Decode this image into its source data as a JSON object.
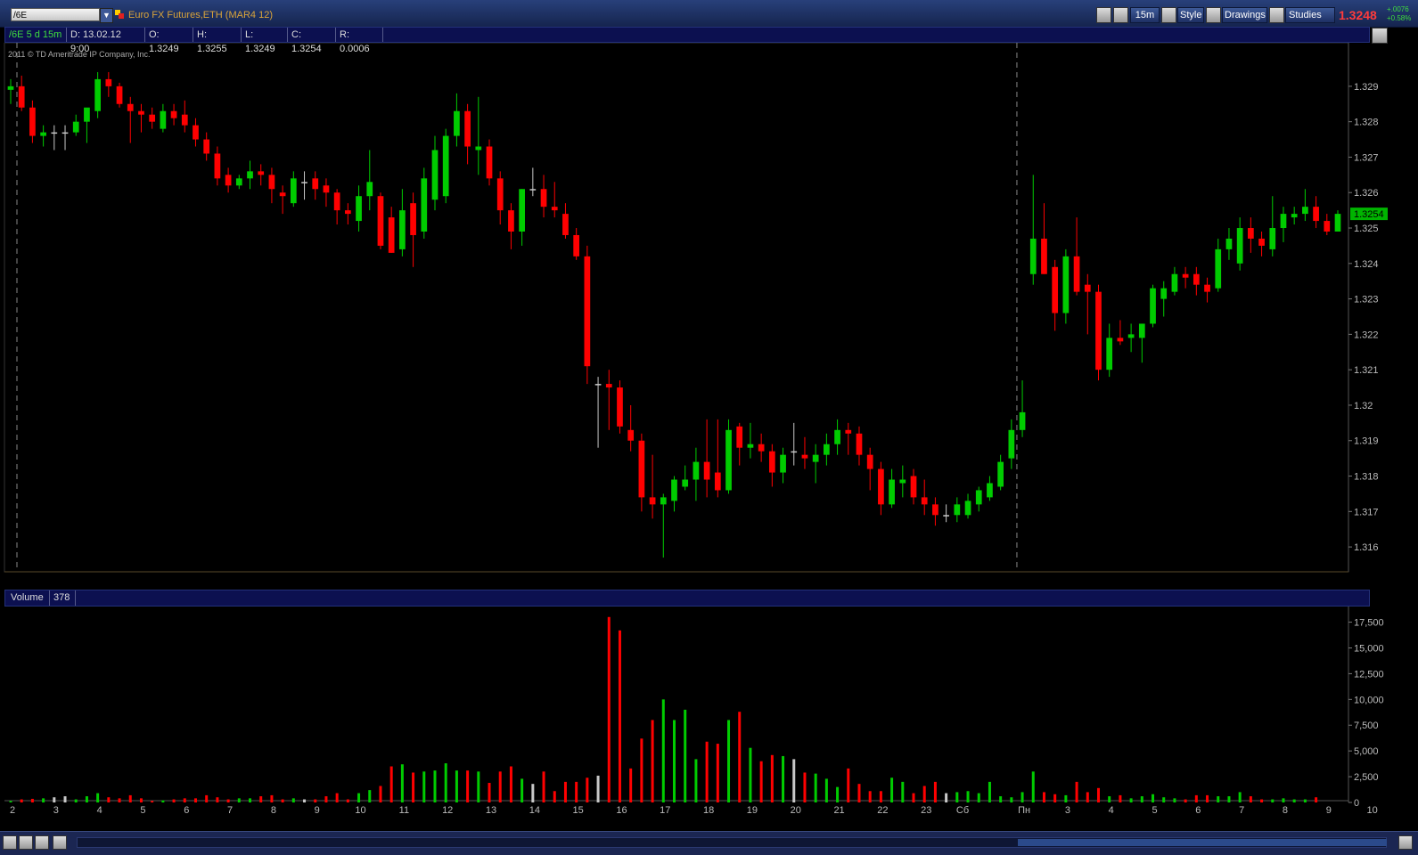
{
  "toolbar": {
    "symbol": "/6E",
    "instrument": "Euro FX Futures,ETH (MAR4 12)",
    "timeframe": "15m",
    "style_label": "Style",
    "drawings_label": "Drawings",
    "studies_label": "Studies",
    "last_price": "1.3248",
    "change_abs": "+.0076",
    "change_pct": "+0.58%",
    "colors": {
      "up": "#00cc00",
      "down": "#ff0000",
      "neutral": "#c8c8c8",
      "price_label_bg": "#00b400"
    }
  },
  "infobar": {
    "period": "/6E 5 d 15m",
    "date": "D: 13.02.12 9:00",
    "open": "O: 1.3249",
    "high": "H: 1.3255",
    "low": "L: 1.3249",
    "close": "C: 1.3254",
    "range": "R: 0.0006"
  },
  "copyright": "2011 © TD Ameritrade IP Company, Inc.",
  "volume_panel": {
    "label": "Volume",
    "value": "378"
  },
  "chart_data": [
    {
      "type": "candlestick",
      "title": "",
      "ylim": [
        1.3155,
        1.3296
      ],
      "y_ticks": [
        "1.329",
        "1.328",
        "1.327",
        "1.326",
        "1.325",
        "1.324",
        "1.323",
        "1.322",
        "1.321",
        "1.32",
        "1.319",
        "1.318",
        "1.317",
        "1.316"
      ],
      "current_price_label": "1.3254",
      "grid": false,
      "session_breaks": [
        0,
        93
      ],
      "x_tick_labels": [
        {
          "label": "2",
          "i": 0
        },
        {
          "label": "3",
          "i": 4
        },
        {
          "label": "4",
          "i": 8
        },
        {
          "label": "5",
          "i": 12
        },
        {
          "label": "6",
          "i": 16
        },
        {
          "label": "7",
          "i": 20
        },
        {
          "label": "8",
          "i": 24
        },
        {
          "label": "9",
          "i": 28
        },
        {
          "label": "10",
          "i": 32
        },
        {
          "label": "11",
          "i": 36
        },
        {
          "label": "12",
          "i": 40
        },
        {
          "label": "13",
          "i": 44
        },
        {
          "label": "14",
          "i": 48
        },
        {
          "label": "15",
          "i": 52
        },
        {
          "label": "16",
          "i": 56
        },
        {
          "label": "17",
          "i": 60
        },
        {
          "label": "18",
          "i": 64
        },
        {
          "label": "19",
          "i": 68
        },
        {
          "label": "20",
          "i": 72
        },
        {
          "label": "21",
          "i": 76
        },
        {
          "label": "22",
          "i": 80
        },
        {
          "label": "23",
          "i": 84
        },
        {
          "label": "Сб",
          "i": 88
        },
        {
          "label": "Пн",
          "i": 93
        },
        {
          "label": "3",
          "i": 97
        },
        {
          "label": "4",
          "i": 101
        },
        {
          "label": "5",
          "i": 105
        },
        {
          "label": "6",
          "i": 109
        },
        {
          "label": "7",
          "i": 113
        },
        {
          "label": "8",
          "i": 117
        },
        {
          "label": "9",
          "i": 121
        },
        {
          "label": "10",
          "i": 125
        }
      ],
      "candles": [
        [
          1.3289,
          1.3292,
          1.3285,
          1.329
        ],
        [
          1.329,
          1.3293,
          1.3283,
          1.3284
        ],
        [
          1.3284,
          1.3286,
          1.3274,
          1.3276
        ],
        [
          1.3276,
          1.3279,
          1.3273,
          1.3277
        ],
        [
          1.3277,
          1.3279,
          1.3272,
          1.3277
        ],
        [
          1.3277,
          1.3279,
          1.3272,
          1.3277
        ],
        [
          1.3277,
          1.3282,
          1.3276,
          1.328
        ],
        [
          1.328,
          1.3283,
          1.3274,
          1.3284
        ],
        [
          1.3283,
          1.3294,
          1.3281,
          1.3292
        ],
        [
          1.3292,
          1.3294,
          1.3287,
          1.329
        ],
        [
          1.329,
          1.3291,
          1.3284,
          1.3285
        ],
        [
          1.3285,
          1.3287,
          1.3274,
          1.3283
        ],
        [
          1.3283,
          1.3285,
          1.3277,
          1.3282
        ],
        [
          1.3282,
          1.3284,
          1.3278,
          1.328
        ],
        [
          1.3278,
          1.3285,
          1.3277,
          1.3283
        ],
        [
          1.3283,
          1.3285,
          1.3279,
          1.3281
        ],
        [
          1.3282,
          1.3286,
          1.3277,
          1.3279
        ],
        [
          1.3279,
          1.3281,
          1.3273,
          1.3275
        ],
        [
          1.3275,
          1.3277,
          1.3269,
          1.3271
        ],
        [
          1.3271,
          1.3273,
          1.3262,
          1.3264
        ],
        [
          1.3265,
          1.3267,
          1.326,
          1.3262
        ],
        [
          1.3262,
          1.3265,
          1.3261,
          1.3264
        ],
        [
          1.3264,
          1.3269,
          1.3261,
          1.3266
        ],
        [
          1.3266,
          1.3268,
          1.3262,
          1.3265
        ],
        [
          1.3265,
          1.3267,
          1.3257,
          1.3261
        ],
        [
          1.326,
          1.3262,
          1.3254,
          1.3259
        ],
        [
          1.3257,
          1.3266,
          1.3256,
          1.3264
        ],
        [
          1.3263,
          1.3266,
          1.3258,
          1.3263
        ],
        [
          1.3264,
          1.3266,
          1.3258,
          1.3261
        ],
        [
          1.3262,
          1.3264,
          1.3256,
          1.326
        ],
        [
          1.326,
          1.3261,
          1.3251,
          1.3255
        ],
        [
          1.3255,
          1.3257,
          1.3251,
          1.3254
        ],
        [
          1.3252,
          1.3262,
          1.3249,
          1.3259
        ],
        [
          1.3259,
          1.3272,
          1.3255,
          1.3263
        ],
        [
          1.3259,
          1.326,
          1.3244,
          1.3245
        ],
        [
          1.3253,
          1.3256,
          1.3243,
          1.3243
        ],
        [
          1.3244,
          1.3261,
          1.3242,
          1.3255
        ],
        [
          1.3257,
          1.326,
          1.3239,
          1.3248
        ],
        [
          1.3249,
          1.3267,
          1.3247,
          1.3264
        ],
        [
          1.3258,
          1.3276,
          1.3255,
          1.3272
        ],
        [
          1.3259,
          1.3278,
          1.3257,
          1.3276
        ],
        [
          1.3276,
          1.3288,
          1.3273,
          1.3283
        ],
        [
          1.3283,
          1.3285,
          1.3268,
          1.3273
        ],
        [
          1.3272,
          1.3287,
          1.3265,
          1.3273
        ],
        [
          1.3273,
          1.3275,
          1.3262,
          1.3264
        ],
        [
          1.3264,
          1.3266,
          1.3251,
          1.3255
        ],
        [
          1.3255,
          1.3257,
          1.3244,
          1.3249
        ],
        [
          1.3249,
          1.3261,
          1.3245,
          1.3261
        ],
        [
          1.3261,
          1.3267,
          1.3259,
          1.3261
        ],
        [
          1.3261,
          1.3265,
          1.3253,
          1.3256
        ],
        [
          1.3256,
          1.3263,
          1.3253,
          1.3255
        ],
        [
          1.3254,
          1.3257,
          1.3247,
          1.3248
        ],
        [
          1.3248,
          1.325,
          1.3241,
          1.3242
        ],
        [
          1.3242,
          1.3245,
          1.3206,
          1.3211
        ],
        [
          1.3206,
          1.3208,
          1.3188,
          1.3206
        ],
        [
          1.3206,
          1.321,
          1.3193,
          1.3205
        ],
        [
          1.3205,
          1.3207,
          1.3192,
          1.3194
        ],
        [
          1.3193,
          1.32,
          1.3187,
          1.319
        ],
        [
          1.319,
          1.3192,
          1.317,
          1.3174
        ],
        [
          1.3174,
          1.3186,
          1.3168,
          1.3172
        ],
        [
          1.3172,
          1.3175,
          1.3157,
          1.3174
        ],
        [
          1.3173,
          1.318,
          1.317,
          1.3179
        ],
        [
          1.3177,
          1.3183,
          1.3176,
          1.3179
        ],
        [
          1.3179,
          1.3188,
          1.3173,
          1.3184
        ],
        [
          1.3184,
          1.3196,
          1.3174,
          1.3179
        ],
        [
          1.3181,
          1.3196,
          1.3174,
          1.3176
        ],
        [
          1.3176,
          1.3196,
          1.3175,
          1.3193
        ],
        [
          1.3194,
          1.3195,
          1.3183,
          1.3188
        ],
        [
          1.3188,
          1.3195,
          1.3185,
          1.3189
        ],
        [
          1.3189,
          1.3192,
          1.3184,
          1.3187
        ],
        [
          1.3187,
          1.3189,
          1.3177,
          1.3181
        ],
        [
          1.3181,
          1.3188,
          1.3178,
          1.3186
        ],
        [
          1.3187,
          1.3195,
          1.3183,
          1.3187
        ],
        [
          1.3186,
          1.3191,
          1.3182,
          1.3185
        ],
        [
          1.3184,
          1.3189,
          1.3178,
          1.3186
        ],
        [
          1.3186,
          1.3192,
          1.3183,
          1.3189
        ],
        [
          1.3189,
          1.3196,
          1.3186,
          1.3193
        ],
        [
          1.3193,
          1.3195,
          1.3186,
          1.3192
        ],
        [
          1.3192,
          1.3194,
          1.3183,
          1.3186
        ],
        [
          1.3186,
          1.3188,
          1.3176,
          1.3182
        ],
        [
          1.3182,
          1.3184,
          1.3169,
          1.3172
        ],
        [
          1.3172,
          1.3182,
          1.3171,
          1.3179
        ],
        [
          1.3178,
          1.3183,
          1.3174,
          1.3179
        ],
        [
          1.318,
          1.3182,
          1.3172,
          1.3174
        ],
        [
          1.3174,
          1.3179,
          1.3169,
          1.3172
        ],
        [
          1.3172,
          1.3174,
          1.3166,
          1.3169
        ],
        [
          1.3169,
          1.3172,
          1.3167,
          1.3169
        ],
        [
          1.3169,
          1.3174,
          1.3167,
          1.3172
        ],
        [
          1.3169,
          1.3175,
          1.3168,
          1.3173
        ],
        [
          1.3172,
          1.3177,
          1.317,
          1.3176
        ],
        [
          1.3174,
          1.318,
          1.3173,
          1.3178
        ],
        [
          1.3177,
          1.3186,
          1.3176,
          1.3184
        ],
        [
          1.3185,
          1.3196,
          1.3182,
          1.3193
        ],
        [
          1.3193,
          1.3207,
          1.3191,
          1.3198
        ],
        [
          1.3237,
          1.3265,
          1.3234,
          1.3247
        ],
        [
          1.3247,
          1.3257,
          1.3237,
          1.3237
        ],
        [
          1.3239,
          1.3241,
          1.3221,
          1.3226
        ],
        [
          1.3226,
          1.3244,
          1.3223,
          1.3242
        ],
        [
          1.3242,
          1.3253,
          1.3231,
          1.3232
        ],
        [
          1.3234,
          1.3237,
          1.322,
          1.3232
        ],
        [
          1.3232,
          1.3234,
          1.3207,
          1.321
        ],
        [
          1.321,
          1.3223,
          1.3208,
          1.3219
        ],
        [
          1.3219,
          1.3224,
          1.3217,
          1.3218
        ],
        [
          1.3219,
          1.3223,
          1.3215,
          1.322
        ],
        [
          1.3219,
          1.3223,
          1.3212,
          1.3223
        ],
        [
          1.3223,
          1.3234,
          1.3222,
          1.3233
        ],
        [
          1.323,
          1.3235,
          1.3225,
          1.3233
        ],
        [
          1.3232,
          1.3239,
          1.3231,
          1.3237
        ],
        [
          1.3237,
          1.3239,
          1.3233,
          1.3236
        ],
        [
          1.3237,
          1.3239,
          1.3231,
          1.3234
        ],
        [
          1.3234,
          1.3236,
          1.3229,
          1.3232
        ],
        [
          1.3233,
          1.3247,
          1.3232,
          1.3244
        ],
        [
          1.3244,
          1.325,
          1.3241,
          1.3247
        ],
        [
          1.324,
          1.3253,
          1.3238,
          1.325
        ],
        [
          1.325,
          1.3253,
          1.3243,
          1.3247
        ],
        [
          1.3247,
          1.3249,
          1.3242,
          1.3245
        ],
        [
          1.3244,
          1.3259,
          1.3242,
          1.325
        ],
        [
          1.325,
          1.3256,
          1.3246,
          1.3254
        ],
        [
          1.3253,
          1.3256,
          1.3251,
          1.3254
        ],
        [
          1.3254,
          1.3261,
          1.3252,
          1.3256
        ],
        [
          1.3256,
          1.3259,
          1.325,
          1.3252
        ],
        [
          1.3252,
          1.3254,
          1.3248,
          1.3249
        ],
        [
          1.3249,
          1.3255,
          1.3249,
          1.3254
        ]
      ]
    },
    {
      "type": "bar",
      "title": "Volume",
      "ylim": [
        0,
        18500
      ],
      "y_ticks": [
        "17,500",
        "15,000",
        "12,500",
        "10,000",
        "7,500",
        "5,000",
        "2,500",
        "0"
      ],
      "values": [
        150,
        300,
        350,
        400,
        500,
        600,
        300,
        600,
        900,
        500,
        400,
        700,
        400,
        150,
        200,
        300,
        400,
        400,
        700,
        500,
        300,
        400,
        400,
        600,
        700,
        300,
        400,
        300,
        300,
        600,
        900,
        300,
        900,
        1200,
        1600,
        3500,
        3700,
        2900,
        3000,
        3100,
        3800,
        3100,
        3100,
        3000,
        1900,
        3000,
        3500,
        2300,
        1800,
        3000,
        1100,
        2000,
        2000,
        2400,
        2600,
        18000,
        16700,
        3300,
        6200,
        8000,
        10000,
        8000,
        9000,
        4200,
        5900,
        5700,
        8000,
        8800,
        5300,
        4000,
        4600,
        4500,
        4200,
        2900,
        2800,
        2300,
        1500,
        3300,
        1800,
        1100,
        1100,
        2400,
        2000,
        900,
        1600,
        2000,
        900,
        1000,
        1100,
        900,
        2000,
        600,
        500,
        1000,
        3000,
        1000,
        800,
        700,
        2000,
        1000,
        1400,
        600,
        700,
        400,
        600,
        800,
        500,
        400,
        300,
        700,
        700,
        600,
        600,
        1000,
        600,
        300,
        300,
        400,
        300,
        300,
        500
      ]
    }
  ]
}
